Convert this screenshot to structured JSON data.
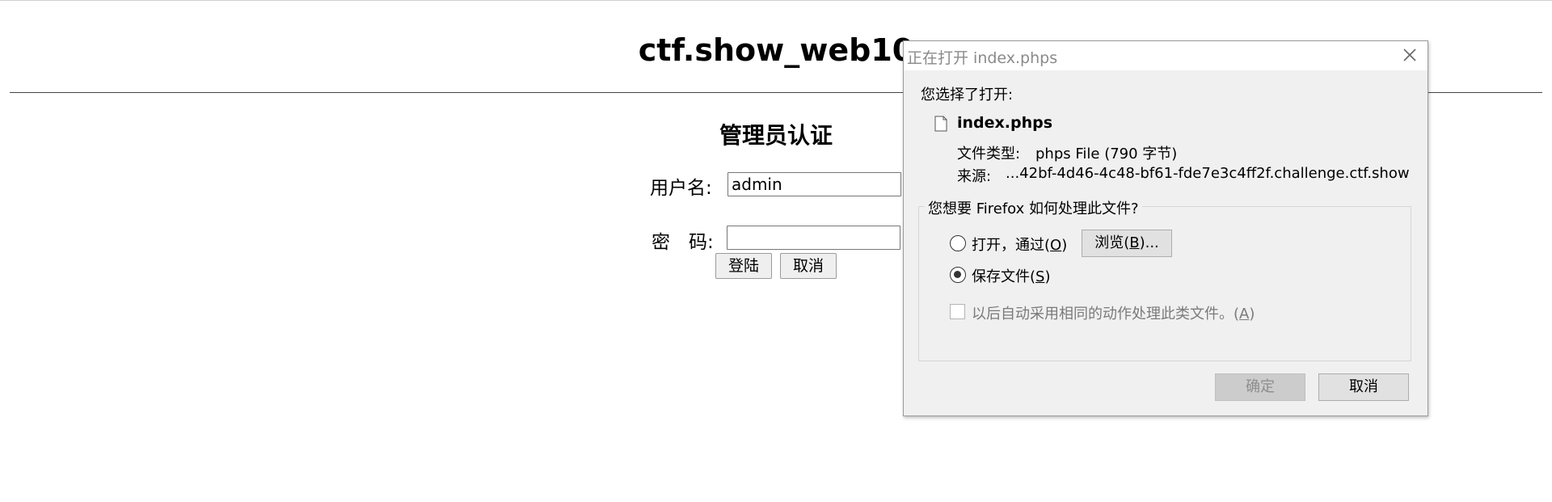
{
  "page": {
    "title": "ctf.show_web10",
    "form_heading": "管理员认证",
    "username_label": "用户名:",
    "username_value": "admin",
    "password_label": "密　码:",
    "password_value": "",
    "login_button": "登陆",
    "cancel_button": "取消"
  },
  "dialog": {
    "title": "正在打开 index.phps",
    "intro": "您选择了打开:",
    "file_name": "index.phps",
    "type_label": "文件类型:",
    "type_value": "phps File (790 字节)",
    "source_label": "来源:",
    "source_value": "...42bf-4d46-4c48-bf61-fde7e3c4ff2f.challenge.ctf.show",
    "question": "您想要 Firefox 如何处理此文件?",
    "open_with_label": "打开，通过(",
    "open_with_key": "O",
    "open_with_suffix": ")",
    "browse_label_pre": "浏览(",
    "browse_key": "B",
    "browse_label_post": ")...",
    "save_label": "保存文件(",
    "save_key": "S",
    "save_suffix": ")",
    "selected_option": "save",
    "remember_label": "以后自动采用相同的动作处理此类文件。(",
    "remember_key": "A",
    "remember_suffix": ")",
    "remember_checked": false,
    "ok_button": "确定",
    "cancel_button": "取消"
  }
}
